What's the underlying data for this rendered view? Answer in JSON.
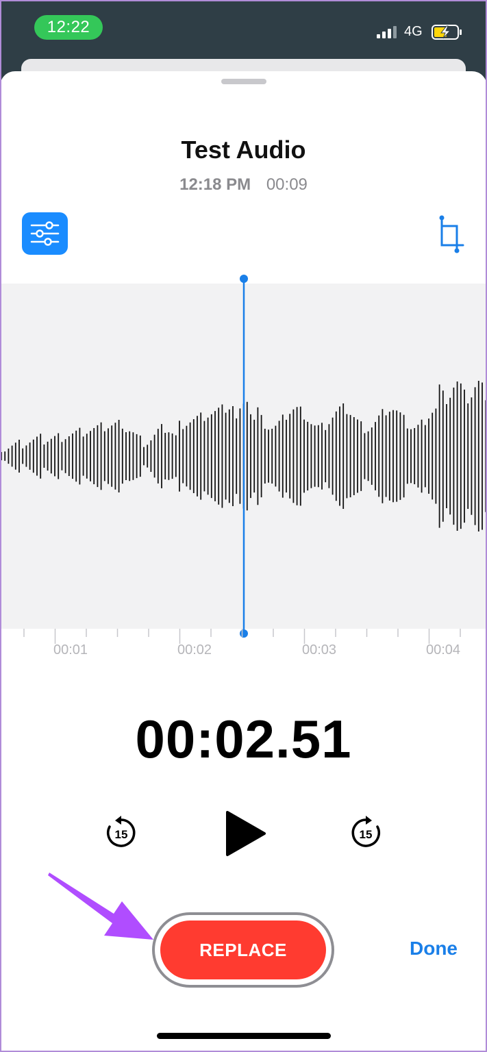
{
  "status_bar": {
    "time": "12:22",
    "network": "4G"
  },
  "recording": {
    "title": "Test Audio",
    "date": "12:18 PM",
    "duration": "00:09"
  },
  "timeline": {
    "labels": [
      "00:01",
      "00:02",
      "00:03",
      "00:04"
    ]
  },
  "player": {
    "elapsed": "00:02.51",
    "skip_back_label": "15",
    "skip_forward_label": "15"
  },
  "actions": {
    "replace_label": "REPLACE",
    "done_label": "Done"
  },
  "colors": {
    "accent": "#1a8cff",
    "replace": "#ff3b30",
    "time_pill": "#34c759",
    "annotation": "#b04dff"
  },
  "icons": [
    "options-icon",
    "trim-icon",
    "skip-back-15-icon",
    "play-icon",
    "skip-forward-15-icon",
    "signal-icon",
    "battery-charging-icon"
  ]
}
